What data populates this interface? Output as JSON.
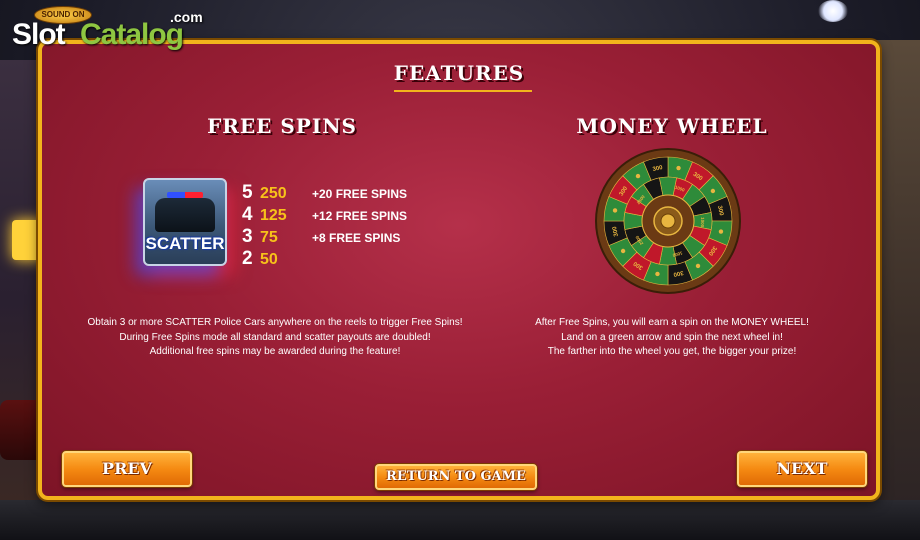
{
  "logo": {
    "badge": "SOUND ON",
    "word_slot": "Slot",
    "word_catalog": "Catalog",
    "suffix": ".com"
  },
  "page": {
    "title": "FEATURES"
  },
  "free_spins": {
    "title": "FREE SPINS",
    "symbol_label": "SCATTER",
    "paytable": [
      {
        "count": "5",
        "value": "250",
        "spins": "+20  FREE SPINS"
      },
      {
        "count": "4",
        "value": "125",
        "spins": "+12  FREE SPINS"
      },
      {
        "count": "3",
        "value": "75",
        "spins": "+8  FREE SPINS"
      },
      {
        "count": "2",
        "value": "50",
        "spins": ""
      }
    ],
    "description": [
      "Obtain 3 or more SCATTER Police Cars anywhere on the reels to trigger Free Spins!",
      "During Free Spins mode all standard and scatter payouts are doubled!",
      "Additional free spins may be awarded during the feature!"
    ]
  },
  "money_wheel": {
    "title": "MONEY WHEEL",
    "outer_values": [
      "300",
      "300",
      "300",
      "300",
      "300",
      "300",
      "300",
      "300"
    ],
    "inner_values": [
      "1000",
      "1000",
      "1000",
      "2500",
      "2500"
    ],
    "description": [
      "After Free Spins, you will earn a spin on the MONEY WHEEL!",
      "Land on a green arrow and spin the next wheel in!",
      "The farther into the wheel you get, the bigger your prize!"
    ],
    "colors": {
      "green": "#2e8b3a",
      "red": "#c0182a",
      "black": "#151515",
      "rim": "#6b3a14",
      "gold": "#e8b640"
    }
  },
  "buttons": {
    "prev": "PREV",
    "return": "RETURN TO GAME",
    "next": "NEXT"
  },
  "colors": {
    "accent": "#f2b41c",
    "panel": "#9a1f36",
    "button": "#f58a12",
    "value_text": "#f7c21a"
  }
}
